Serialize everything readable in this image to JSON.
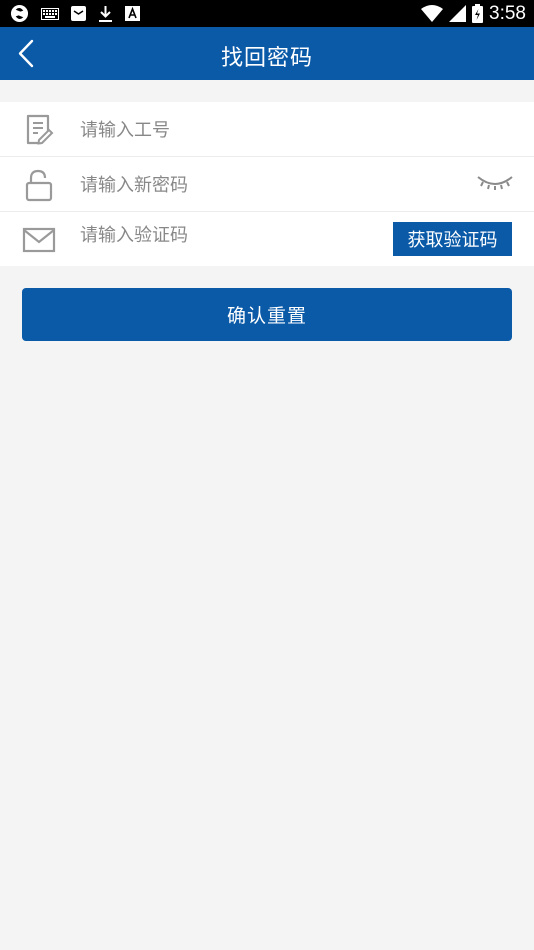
{
  "status_bar": {
    "time": "3:58",
    "icons": [
      "sync-icon",
      "keyboard-icon",
      "mail-notification-icon",
      "download-icon",
      "app-a-icon",
      "wifi-icon",
      "signal-icon",
      "battery-icon"
    ]
  },
  "header": {
    "title": "找回密码",
    "back_icon": "chevron-left-icon"
  },
  "form": {
    "employee_id": {
      "placeholder": "请输入工号",
      "value": "",
      "icon": "document-edit-icon"
    },
    "new_password": {
      "placeholder": "请输入新密码",
      "value": "",
      "icon": "lock-icon",
      "toggle_icon": "eye-closed-icon"
    },
    "verification_code": {
      "placeholder": "请输入验证码",
      "value": "",
      "icon": "mail-icon",
      "button_label": "获取验证码"
    }
  },
  "actions": {
    "confirm_label": "确认重置"
  },
  "colors": {
    "primary": "#0a5aa8",
    "background": "#f4f4f4",
    "status_bar": "#000000",
    "icon_gray": "#9a9a9a"
  }
}
